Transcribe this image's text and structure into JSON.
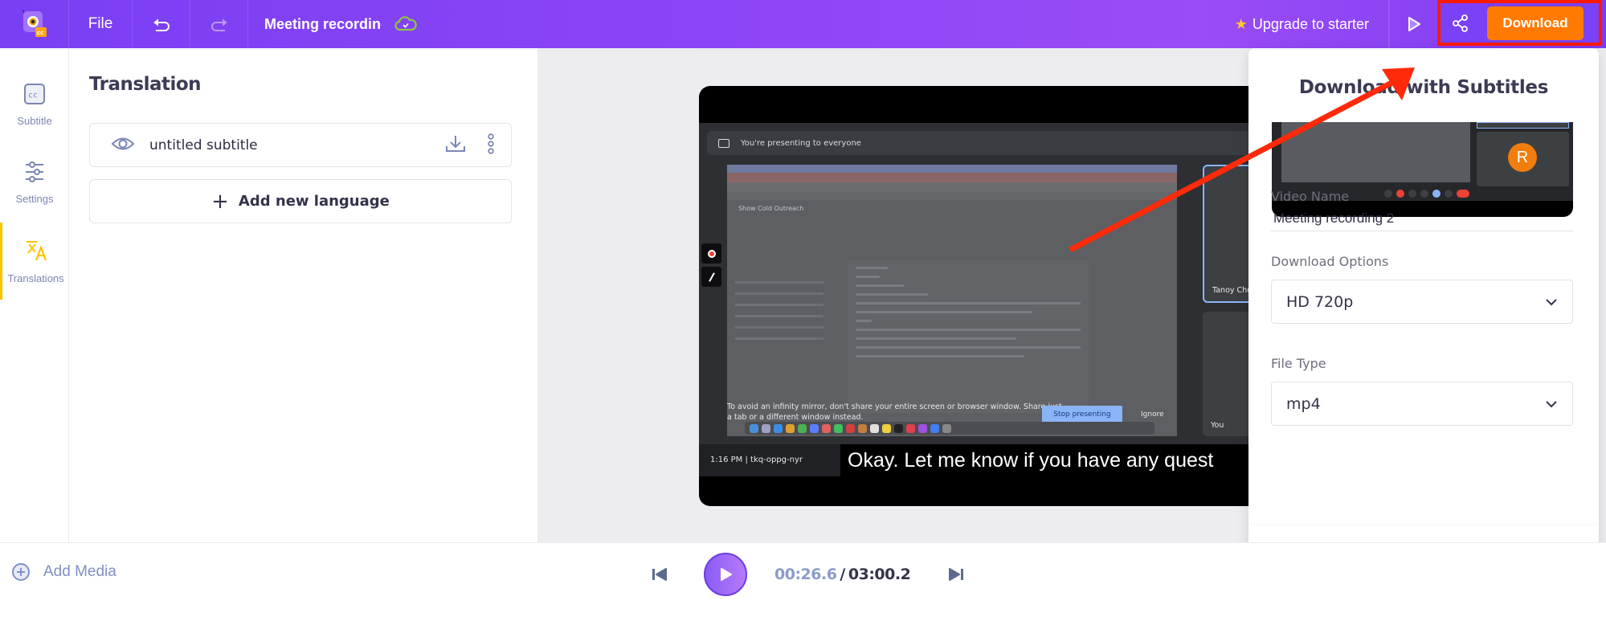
{
  "topbar": {
    "file_label": "File",
    "project_title": "Meeting recording 2",
    "project_title_visible": "Meeting recordir",
    "upgrade_label": "Upgrade to starter",
    "download_label": "Download",
    "icons": {
      "logo": "app-logo-icon",
      "undo": "undo-icon",
      "redo": "redo-icon",
      "cloud": "cloud-saved-icon",
      "star": "star-icon",
      "preview": "play-preview-icon",
      "share": "share-icon"
    },
    "colors": {
      "accent": "#8a44f6",
      "download": "#ff7a00",
      "highlight_box": "#ff1a00"
    }
  },
  "sidebar": {
    "items": [
      {
        "label": "Subtitle",
        "icon": "closed-caption-icon",
        "active": false
      },
      {
        "label": "Settings",
        "icon": "sliders-icon",
        "active": false
      },
      {
        "label": "Translations",
        "icon": "translate-icon",
        "active": true
      }
    ]
  },
  "translation_panel": {
    "title": "Translation",
    "subtitles": [
      {
        "name": "untitled subtitle"
      }
    ],
    "add_language_label": "Add new language"
  },
  "video": {
    "presenting_banner": "You're presenting to everyone",
    "infinity_warning": "To avoid an infinity mirror, don't share your entire screen or browser window. Share just a tab or a different window instead.",
    "stop_presenting_label": "Stop presenting",
    "ignore_label": "Ignore",
    "doc_title": "Show Cold Outreach",
    "participant_tiles": [
      "Tanoy Cho",
      "You"
    ],
    "meeting_time": "1:16 PM  |  tkq-oppg-nyr",
    "caption": "Okay. Let me know if you have any quest"
  },
  "download_panel": {
    "title": "Download with Subtitles",
    "thumbnail_avatar": "R",
    "video_name_label": "Video Name",
    "video_name_value": "Meeting recording 2",
    "download_options_label": "Download Options",
    "download_options_value": "HD 720p",
    "file_type_label": "File Type",
    "file_type_value": "mp4",
    "download_button_label": "Download"
  },
  "bottombar": {
    "add_media_label": "Add Media",
    "current_time": "00:26.6",
    "separator": "/",
    "total_time": "03:00.2"
  }
}
